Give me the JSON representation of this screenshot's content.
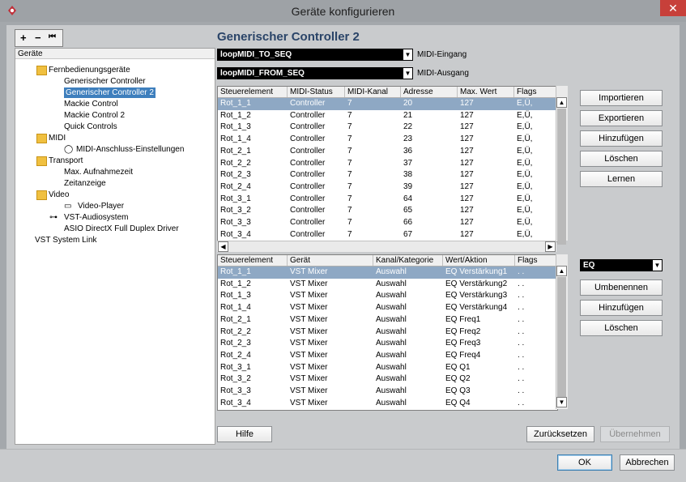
{
  "window": {
    "title": "Geräte konfigurieren",
    "close_glyph": "✕"
  },
  "toolbar": {
    "add": "+",
    "remove": "−",
    "reset": "⏮"
  },
  "tree": {
    "header": "Geräte",
    "items": [
      {
        "label": "Fernbedienungsgeräte",
        "icon": "folder-icon"
      },
      {
        "label": "Generischer Controller"
      },
      {
        "label": "Generischer Controller 2",
        "selected": true
      },
      {
        "label": "Mackie Control"
      },
      {
        "label": "Mackie Control 2"
      },
      {
        "label": "Quick Controls"
      },
      {
        "label": "MIDI",
        "icon": "folder-icon"
      },
      {
        "label": "MIDI-Anschluss-Einstellungen",
        "icon": "midi-port-icon"
      },
      {
        "label": "Transport",
        "icon": "folder-icon"
      },
      {
        "label": "Max. Aufnahmezeit"
      },
      {
        "label": "Zeitanzeige"
      },
      {
        "label": "Video",
        "icon": "folder-icon"
      },
      {
        "label": "Video-Player",
        "icon": "video-icon"
      },
      {
        "label": "VST-Audiosystem",
        "icon": "audio-system-icon"
      },
      {
        "label": "ASIO DirectX Full Duplex Driver"
      },
      {
        "label": "VST System Link"
      }
    ]
  },
  "main": {
    "heading": "Generischer Controller 2",
    "midi_in": {
      "value": "loopMIDI_TO_SEQ",
      "label": "MIDI-Eingang"
    },
    "midi_out": {
      "value": "loopMIDI_FROM_SEQ",
      "label": "MIDI-Ausgang"
    }
  },
  "table1": {
    "columns": [
      "Steuerelement",
      "MIDI-Status",
      "MIDI-Kanal",
      "Adresse",
      "Max. Wert",
      "Flags"
    ],
    "rows": [
      [
        "Rot_1_1",
        "Controller",
        "7",
        "20",
        "127",
        "E,Ü,"
      ],
      [
        "Rot_1_2",
        "Controller",
        "7",
        "21",
        "127",
        "E,Ü,"
      ],
      [
        "Rot_1_3",
        "Controller",
        "7",
        "22",
        "127",
        "E,Ü,"
      ],
      [
        "Rot_1_4",
        "Controller",
        "7",
        "23",
        "127",
        "E,Ü,"
      ],
      [
        "Rot_2_1",
        "Controller",
        "7",
        "36",
        "127",
        "E,Ü,"
      ],
      [
        "Rot_2_2",
        "Controller",
        "7",
        "37",
        "127",
        "E,Ü,"
      ],
      [
        "Rot_2_3",
        "Controller",
        "7",
        "38",
        "127",
        "E,Ü,"
      ],
      [
        "Rot_2_4",
        "Controller",
        "7",
        "39",
        "127",
        "E,Ü,"
      ],
      [
        "Rot_3_1",
        "Controller",
        "7",
        "64",
        "127",
        "E,Ü,"
      ],
      [
        "Rot_3_2",
        "Controller",
        "7",
        "65",
        "127",
        "E,Ü,"
      ],
      [
        "Rot_3_3",
        "Controller",
        "7",
        "66",
        "127",
        "E,Ü,"
      ],
      [
        "Rot_3_4",
        "Controller",
        "7",
        "67",
        "127",
        "E,Ü,"
      ]
    ]
  },
  "table1_buttons": {
    "import": "Importieren",
    "export": "Exportieren",
    "add": "Hinzufügen",
    "delete": "Löschen",
    "learn": "Lernen"
  },
  "table2": {
    "columns": [
      "Steuerelement",
      "Gerät",
      "Kanal/Kategorie",
      "Wert/Aktion",
      "Flags"
    ],
    "rows": [
      [
        "Rot_1_1",
        "VST Mixer",
        "Auswahl",
        "EQ Verstärkung1",
        ". ."
      ],
      [
        "Rot_1_2",
        "VST Mixer",
        "Auswahl",
        "EQ Verstärkung2",
        ". ."
      ],
      [
        "Rot_1_3",
        "VST Mixer",
        "Auswahl",
        "EQ Verstärkung3",
        ". ."
      ],
      [
        "Rot_1_4",
        "VST Mixer",
        "Auswahl",
        "EQ Verstärkung4",
        ". ."
      ],
      [
        "Rot_2_1",
        "VST Mixer",
        "Auswahl",
        "EQ Freq1",
        ". ."
      ],
      [
        "Rot_2_2",
        "VST Mixer",
        "Auswahl",
        "EQ Freq2",
        ". ."
      ],
      [
        "Rot_2_3",
        "VST Mixer",
        "Auswahl",
        "EQ Freq3",
        ". ."
      ],
      [
        "Rot_2_4",
        "VST Mixer",
        "Auswahl",
        "EQ Freq4",
        ". ."
      ],
      [
        "Rot_3_1",
        "VST Mixer",
        "Auswahl",
        "EQ Q1",
        ". ."
      ],
      [
        "Rot_3_2",
        "VST Mixer",
        "Auswahl",
        "EQ Q2",
        ". ."
      ],
      [
        "Rot_3_3",
        "VST Mixer",
        "Auswahl",
        "EQ Q3",
        ". ."
      ],
      [
        "Rot_3_4",
        "VST Mixer",
        "Auswahl",
        "EQ Q4",
        ". ."
      ]
    ]
  },
  "bank": {
    "value": "EQ"
  },
  "table2_buttons": {
    "rename": "Umbenennen",
    "add": "Hinzufügen",
    "delete": "Löschen"
  },
  "bottom": {
    "help": "Hilfe",
    "reset": "Zurücksetzen",
    "apply": "Übernehmen"
  },
  "footer": {
    "ok": "OK",
    "cancel": "Abbrechen"
  }
}
